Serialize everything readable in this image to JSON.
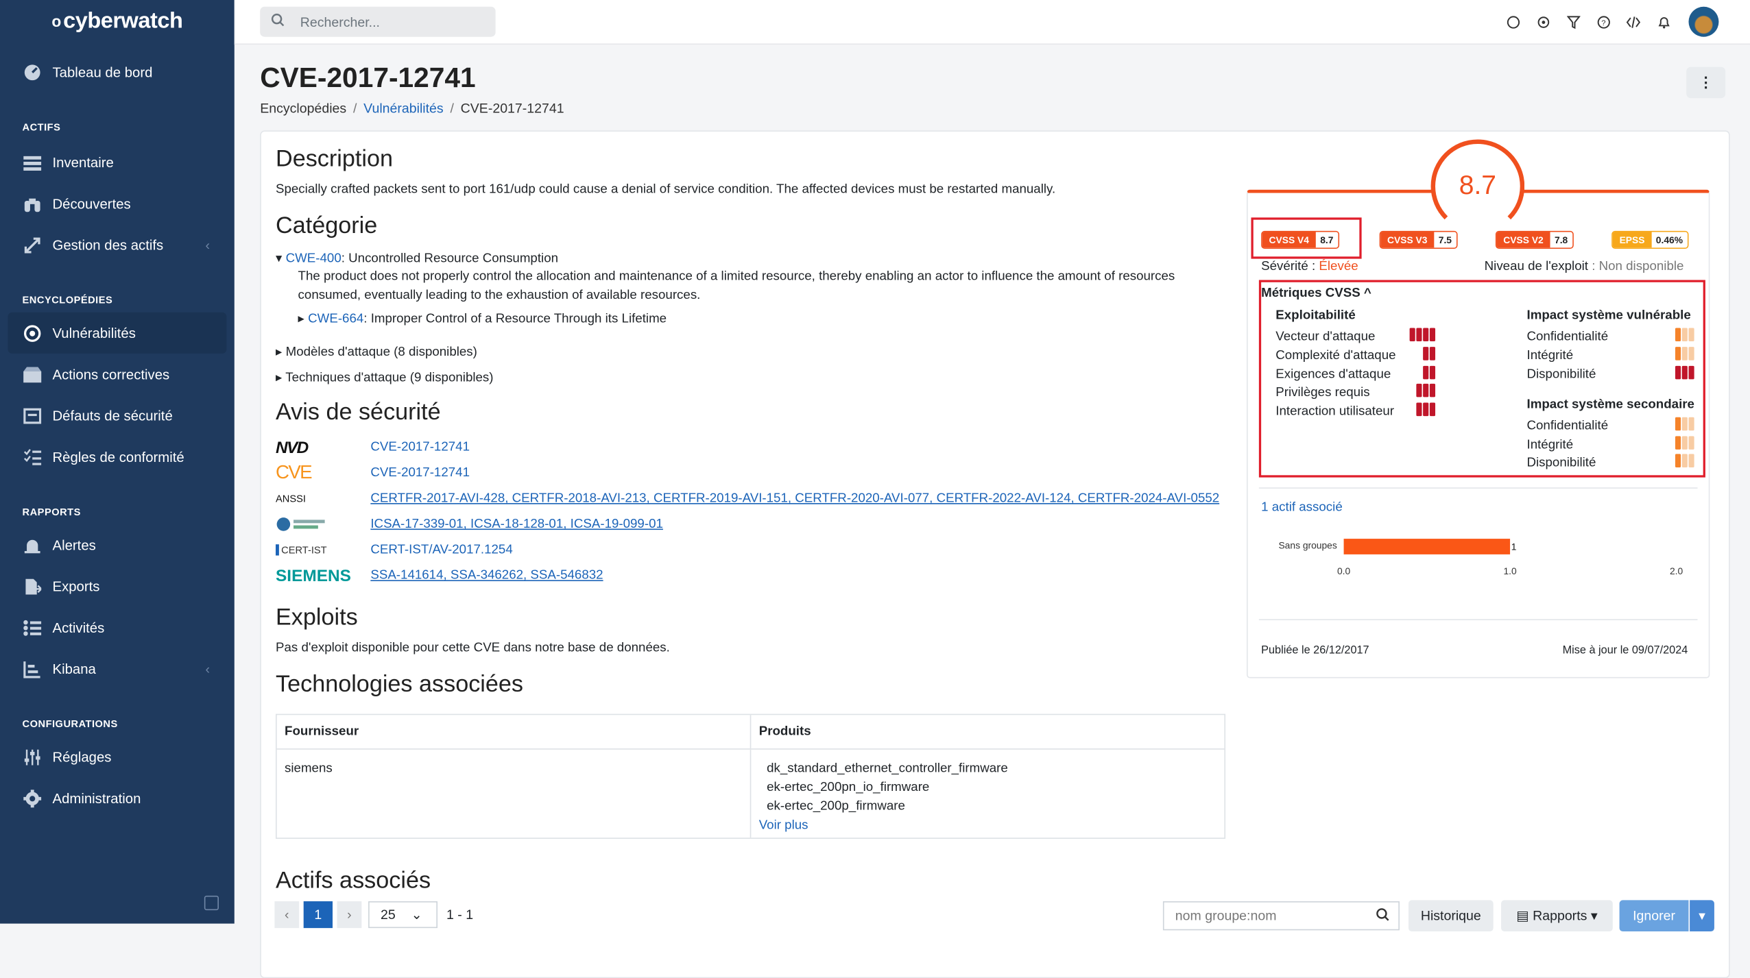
{
  "brand": "cyberwatch",
  "sidebar": {
    "dashboard": "Tableau de bord",
    "sec_actifs": "ACTIFS",
    "inventaire": "Inventaire",
    "decouvertes": "Découvertes",
    "gestion": "Gestion des actifs",
    "sec_encyclo": "ENCYCLOPÉDIES",
    "vulns": "Vulnérabilités",
    "actions": "Actions correctives",
    "defauts": "Défauts de sécurité",
    "regles": "Règles de conformité",
    "sec_rapports": "RAPPORTS",
    "alertes": "Alertes",
    "exports": "Exports",
    "activites": "Activités",
    "kibana": "Kibana",
    "sec_config": "CONFIGURATIONS",
    "reglages": "Réglages",
    "admin": "Administration"
  },
  "search": {
    "placeholder": "Rechercher..."
  },
  "page": {
    "title": "CVE-2017-12741",
    "breadcrumb": [
      "Encyclopédies",
      "Vulnérabilités",
      "CVE-2017-12741"
    ]
  },
  "description": {
    "heading": "Description",
    "text": "Specially crafted packets sent to port 161/udp could cause a denial of service condition. The affected devices must be restarted manually."
  },
  "categorie": {
    "heading": "Catégorie",
    "cwe_id": "CWE-400",
    "cwe_name": ": Uncontrolled Resource Consumption",
    "cwe_desc": "The product does not properly control the allocation and maintenance of a limited resource, thereby enabling an actor to influence the amount of resources consumed, eventually leading to the exhaustion of available resources.",
    "parent_id": "CWE-664",
    "parent_name": ": Improper Control of a Resource Through its Lifetime",
    "modeles": "Modèles d'attaque (8 disponibles)",
    "techniques": "Techniques d'attaque (9 disponibles)"
  },
  "avis": {
    "heading": "Avis de sécurité",
    "rows": [
      {
        "source": "NVD",
        "links": "CVE-2017-12741"
      },
      {
        "source": "CVE",
        "links": "CVE-2017-12741"
      },
      {
        "source": "ANSSI",
        "links": "CERTFR-2017-AVI-428, CERTFR-2018-AVI-213, CERTFR-2019-AVI-151, CERTFR-2020-AVI-077, CERTFR-2022-AVI-124, CERTFR-2024-AVI-0552"
      },
      {
        "source": "ICS-CERT",
        "links": "ICSA-17-339-01, ICSA-18-128-01, ICSA-19-099-01"
      },
      {
        "source": "CERT-IST",
        "links": "CERT-IST/AV-2017.1254"
      },
      {
        "source": "SIEMENS",
        "links": "SSA-141614, SSA-346262, SSA-546832"
      }
    ]
  },
  "exploits": {
    "heading": "Exploits",
    "text": "Pas d'exploit disponible pour cette CVE dans notre base de données."
  },
  "technologies": {
    "heading": "Technologies associées",
    "col1": "Fournisseur",
    "col2": "Produits",
    "vendor": "siemens",
    "products": [
      "dk_standard_ethernet_controller_firmware",
      "ek-ertec_200pn_io_firmware",
      "ek-ertec_200p_firmware"
    ],
    "more": "Voir plus"
  },
  "actifs": {
    "heading": "Actifs associés",
    "page": "1",
    "per_page": "25",
    "range": "1 - 1",
    "filter_placeholder": "nom groupe:nom",
    "historique": "Historique",
    "rapports": "Rapports",
    "ignorer": "Ignorer"
  },
  "score": {
    "value": "8.7",
    "pills": [
      {
        "name": "CVSS V4",
        "value": "8.7"
      },
      {
        "name": "CVSS V3",
        "value": "7.5"
      },
      {
        "name": "CVSS V2",
        "value": "7.8"
      },
      {
        "name": "EPSS",
        "value": "0.46%"
      }
    ],
    "severity_label": "Sévérité : ",
    "severity": "Élevée",
    "exploit_label": "Niveau de l'exploit",
    "exploit_value": ": Non disponible",
    "metrics_title": "Métriques CVSS",
    "exploitability": "Exploitabilité",
    "expl_items": [
      "Vecteur d'attaque",
      "Complexité d'attaque",
      "Exigences d'attaque",
      "Privilèges requis",
      "Interaction utilisateur"
    ],
    "impact_vuln": "Impact système vulnérable",
    "impact_sec": "Impact système secondaire",
    "impact_items": [
      "Confidentialité",
      "Intégrité",
      "Disponibilité"
    ],
    "assets_link": "1 actif associé",
    "published": "Publiée le 26/12/2017",
    "updated": "Mise à jour le 09/07/2024"
  },
  "chart_data": {
    "type": "bar",
    "categories": [
      "Sans groupes"
    ],
    "values": [
      1
    ],
    "xticks": [
      "0.0",
      "1.0",
      "2.0"
    ],
    "xlim": [
      0,
      2
    ]
  },
  "colors": {
    "accent": "#f0501e",
    "sidebar": "#1f3a5e",
    "link": "#1c64b8",
    "highlight": "#e01e2b"
  }
}
